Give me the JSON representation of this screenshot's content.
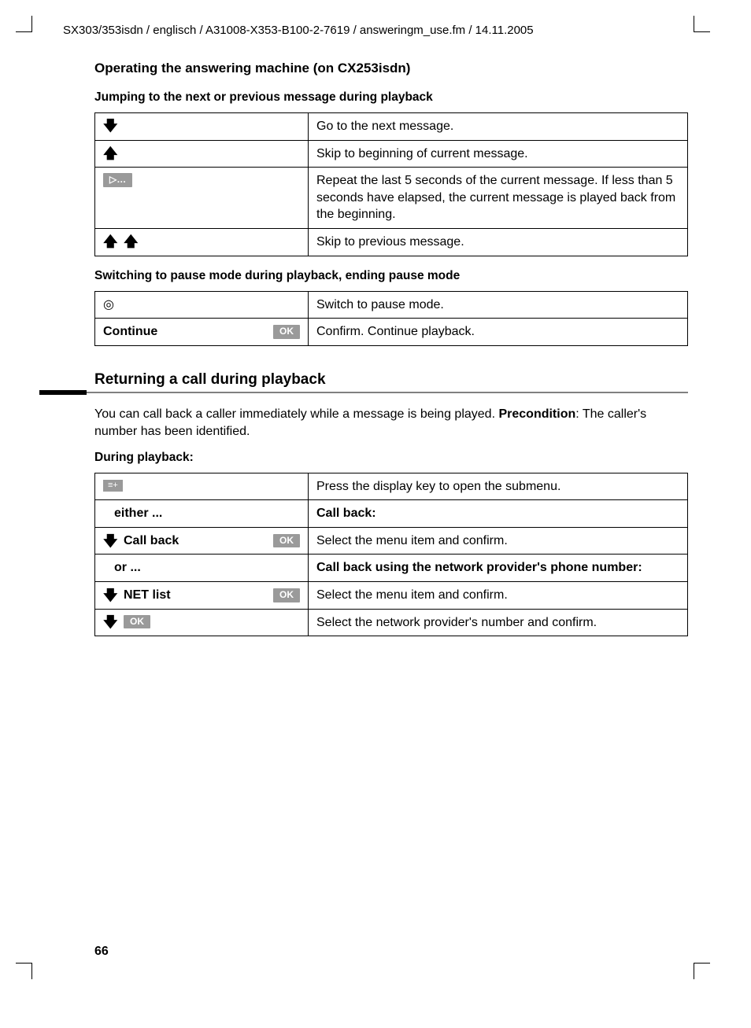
{
  "header": "SX303/353isdn / englisch / A31008-X353-B100-2-7619 / answeringm_use.fm / 14.11.2005",
  "title": "Operating the answering machine   (on CX253isdn)",
  "sec1": {
    "heading": "Jumping to the next or previous message during playback",
    "rows": [
      {
        "icons": [
          "down"
        ],
        "desc": "Go to the next message."
      },
      {
        "icons": [
          "up"
        ],
        "desc": "Skip to beginning of current message."
      },
      {
        "icons": [
          "repeat"
        ],
        "desc": "Repeat the last 5 seconds of the current message. If less than 5 seconds have elapsed, the current message is played back from the beginning."
      },
      {
        "icons": [
          "up",
          "up"
        ],
        "desc": "Skip to previous message."
      }
    ]
  },
  "sec2": {
    "heading": "Switching to pause mode during playback, ending pause mode",
    "rows": [
      {
        "left_kind": "am_icon",
        "desc": "Switch to pause mode."
      },
      {
        "left_kind": "continue_ok",
        "left_label": "Continue",
        "ok": "OK",
        "desc": "Confirm. Continue playback."
      }
    ]
  },
  "sec3": {
    "heading": "Returning a call during playback",
    "para_prefix": "You can call back a caller immediately while a message is being played. ",
    "precond_label": "Precondition",
    "para_suffix": ": The caller's number has been identified.",
    "during": "During playback:",
    "rows": [
      {
        "left_kind": "menu",
        "desc": "Press the display key to open the submenu."
      },
      {
        "left_kind": "plain_bold",
        "left_label": "either ...",
        "desc_bold": "Call back:"
      },
      {
        "left_kind": "arrow_label_ok",
        "left_label": "Call back",
        "ok": "OK",
        "desc": "Select the menu item and confirm."
      },
      {
        "left_kind": "plain_bold",
        "left_label": "or ...",
        "desc_bold": "Call back using the network provider's phone number:"
      },
      {
        "left_kind": "arrow_label_ok",
        "left_label": "NET list",
        "ok": "OK",
        "desc": "Select the menu item and confirm."
      },
      {
        "left_kind": "arrow_ok",
        "ok": "OK",
        "desc": "Select the network provider's number and confirm."
      }
    ]
  },
  "page_number": "66",
  "glyphs": {
    "down": "🡇",
    "up": "🡅",
    "repeat": "▷…",
    "menu": "≡+",
    "am": "◎"
  }
}
